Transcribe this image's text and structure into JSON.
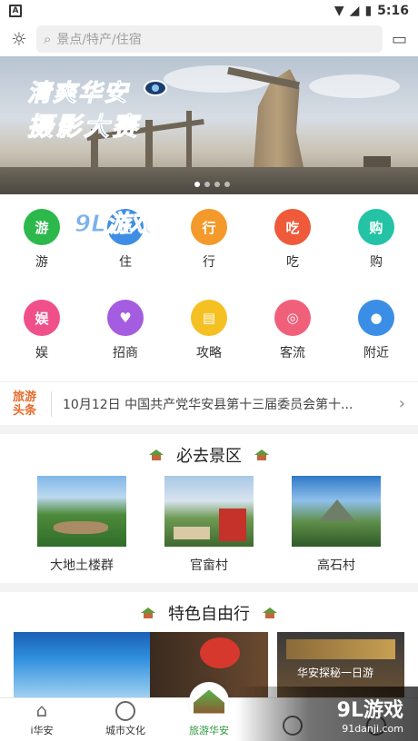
{
  "status_bar": {
    "time": "5:16"
  },
  "search": {
    "placeholder": "景点/特产/住宿"
  },
  "banner": {
    "line1": "清爽华安",
    "line2": "摄影大赛"
  },
  "categories": [
    {
      "label": "游",
      "glyph": "游",
      "color": "#2cb84a",
      "icon": "play-icon"
    },
    {
      "label": "住",
      "glyph": "住",
      "color": "#3f8ee6",
      "icon": "bed-icon"
    },
    {
      "label": "行",
      "glyph": "行",
      "color": "#f39a2b",
      "icon": "road-icon"
    },
    {
      "label": "吃",
      "glyph": "吃",
      "color": "#ee5a3a",
      "icon": "food-icon"
    },
    {
      "label": "购",
      "glyph": "购",
      "color": "#24c3a6",
      "icon": "cart-icon"
    },
    {
      "label": "娱",
      "glyph": "娱",
      "color": "#f0508a",
      "icon": "fun-icon"
    },
    {
      "label": "招商",
      "glyph": "♥",
      "color": "#a45ce0",
      "icon": "handshake-icon"
    },
    {
      "label": "攻略",
      "glyph": "▤",
      "color": "#f5c022",
      "icon": "book-icon"
    },
    {
      "label": "客流",
      "glyph": "◎",
      "color": "#f0607a",
      "icon": "flow-icon"
    },
    {
      "label": "附近",
      "glyph": "●",
      "color": "#3a8ee6",
      "icon": "location-pin-icon"
    }
  ],
  "watermark_top": "9L游戏",
  "news": {
    "tag": "旅游头条",
    "text": "10月12日 中国共产党华安县第十三届委员会第十..."
  },
  "sections": {
    "must_go": {
      "title": "必去景区"
    },
    "free_travel": {
      "title": "特色自由行"
    }
  },
  "spots": [
    {
      "label": "大地土楼群"
    },
    {
      "label": "官畲村"
    },
    {
      "label": "高石村"
    }
  ],
  "feature_caption": "华安探秘一日游",
  "tabs": [
    {
      "label": "i华安"
    },
    {
      "label": "城市文化"
    },
    {
      "label": "旅游华安"
    },
    {
      "label": ""
    },
    {
      "label": ""
    }
  ],
  "watermark_bottom": {
    "big": "9L游戏",
    "small": "91danji.com"
  }
}
